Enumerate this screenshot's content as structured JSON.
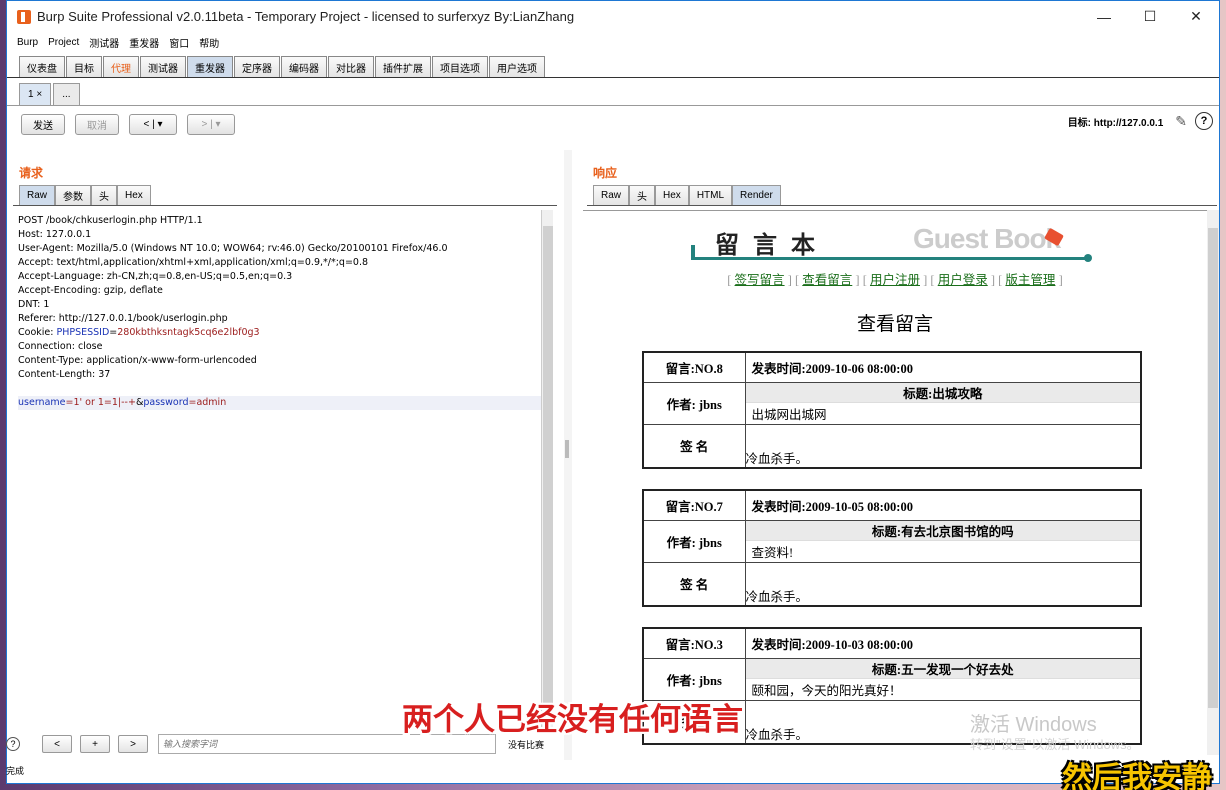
{
  "window": {
    "title": "Burp Suite Professional v2.0.11beta - Temporary Project - licensed to surferxyz By:LianZhang",
    "minimize": "—",
    "maximize": "☐",
    "close": "✕"
  },
  "menu": [
    "Burp",
    "Project",
    "测试器",
    "重发器",
    "窗口",
    "帮助"
  ],
  "tool_tabs": [
    {
      "label": "仪表盘"
    },
    {
      "label": "目标"
    },
    {
      "label": "代理"
    },
    {
      "label": "测试器"
    },
    {
      "label": "重发器"
    },
    {
      "label": "定序器"
    },
    {
      "label": "编码器"
    },
    {
      "label": "对比器"
    },
    {
      "label": "插件扩展"
    },
    {
      "label": "项目选项"
    },
    {
      "label": "用户选项"
    }
  ],
  "repeater_tabs": [
    {
      "label": "1 ×"
    },
    {
      "label": "..."
    }
  ],
  "actions": {
    "send": "发送",
    "cancel": "取消",
    "back": "< | ▾",
    "forward": "> | ▾",
    "target_label": "目标: http://127.0.0.1"
  },
  "request": {
    "title": "请求",
    "tabs": [
      "Raw",
      "参数",
      "头",
      "Hex"
    ],
    "lines": [
      "POST /book/chkuserlogin.php HTTP/1.1",
      "Host: 127.0.0.1",
      "User-Agent: Mozilla/5.0 (Windows NT 10.0; WOW64; rv:46.0) Gecko/20100101 Firefox/46.0",
      "Accept: text/html,application/xhtml+xml,application/xml;q=0.9,*/*;q=0.8",
      "Accept-Language: zh-CN,zh;q=0.8,en-US;q=0.5,en;q=0.3",
      "Accept-Encoding: gzip, deflate",
      "DNT: 1",
      "Referer: http://127.0.0.1/book/userlogin.php"
    ],
    "cookie_prefix": "Cookie: ",
    "cookie_name": "PHPSESSID",
    "cookie_eq": "=",
    "cookie_value": "280kbthksntagk5cq6e2lbf0g3",
    "lines_after": [
      "Connection: close",
      "Content-Type: application/x-www-form-urlencoded",
      "Content-Length: 37"
    ],
    "body_p1": "username",
    "body_v1": "=1' or 1=1|--+",
    "body_amp": "&",
    "body_p2": "password",
    "body_v2": "=admin"
  },
  "search": {
    "help": "?",
    "prev": "<",
    "add": "+",
    "next": ">",
    "placeholder": "输入搜索字词",
    "result": "没有比赛"
  },
  "status": "完成",
  "response": {
    "title": "响应",
    "tabs": [
      "Raw",
      "头",
      "Hex",
      "HTML",
      "Render"
    ]
  },
  "page": {
    "logo_cn": "留 言 本",
    "logo_en": "Guest Book",
    "nav": [
      "签写留言",
      "查看留言",
      "用户注册",
      "用户登录",
      "版主管理"
    ],
    "heading": "查看留言",
    "messages": [
      {
        "no": "留言:NO.8",
        "time": "发表时间:2009-10-06 08:00:00",
        "author": "作者: jbns",
        "subject": "标题:出城攻略",
        "content": "出城网出城网",
        "sign_label": "签 名",
        "sign": "冷血杀手。"
      },
      {
        "no": "留言:NO.7",
        "time": "发表时间:2009-10-05 08:00:00",
        "author": "作者: jbns",
        "subject": "标题:有去北京图书馆的吗",
        "content": "查资料!",
        "sign_label": "签 名",
        "sign": "冷血杀手。"
      },
      {
        "no": "留言:NO.3",
        "time": "发表时间:2009-10-03 08:00:00",
        "author": "作者: jbns",
        "subject": "标题:五一发现一个好去处",
        "content": "颐和园，今天的阳光真好！",
        "sign_label": "签名",
        "sign": "冷血杀手。"
      }
    ]
  },
  "overlay": {
    "watermark_line1": "激活 Windows",
    "watermark_line2": "转到\"设置\"以激活 Windows。",
    "subtitle_main": "两个人已经没有任何语言",
    "subtitle_corner": "然后我安静"
  }
}
